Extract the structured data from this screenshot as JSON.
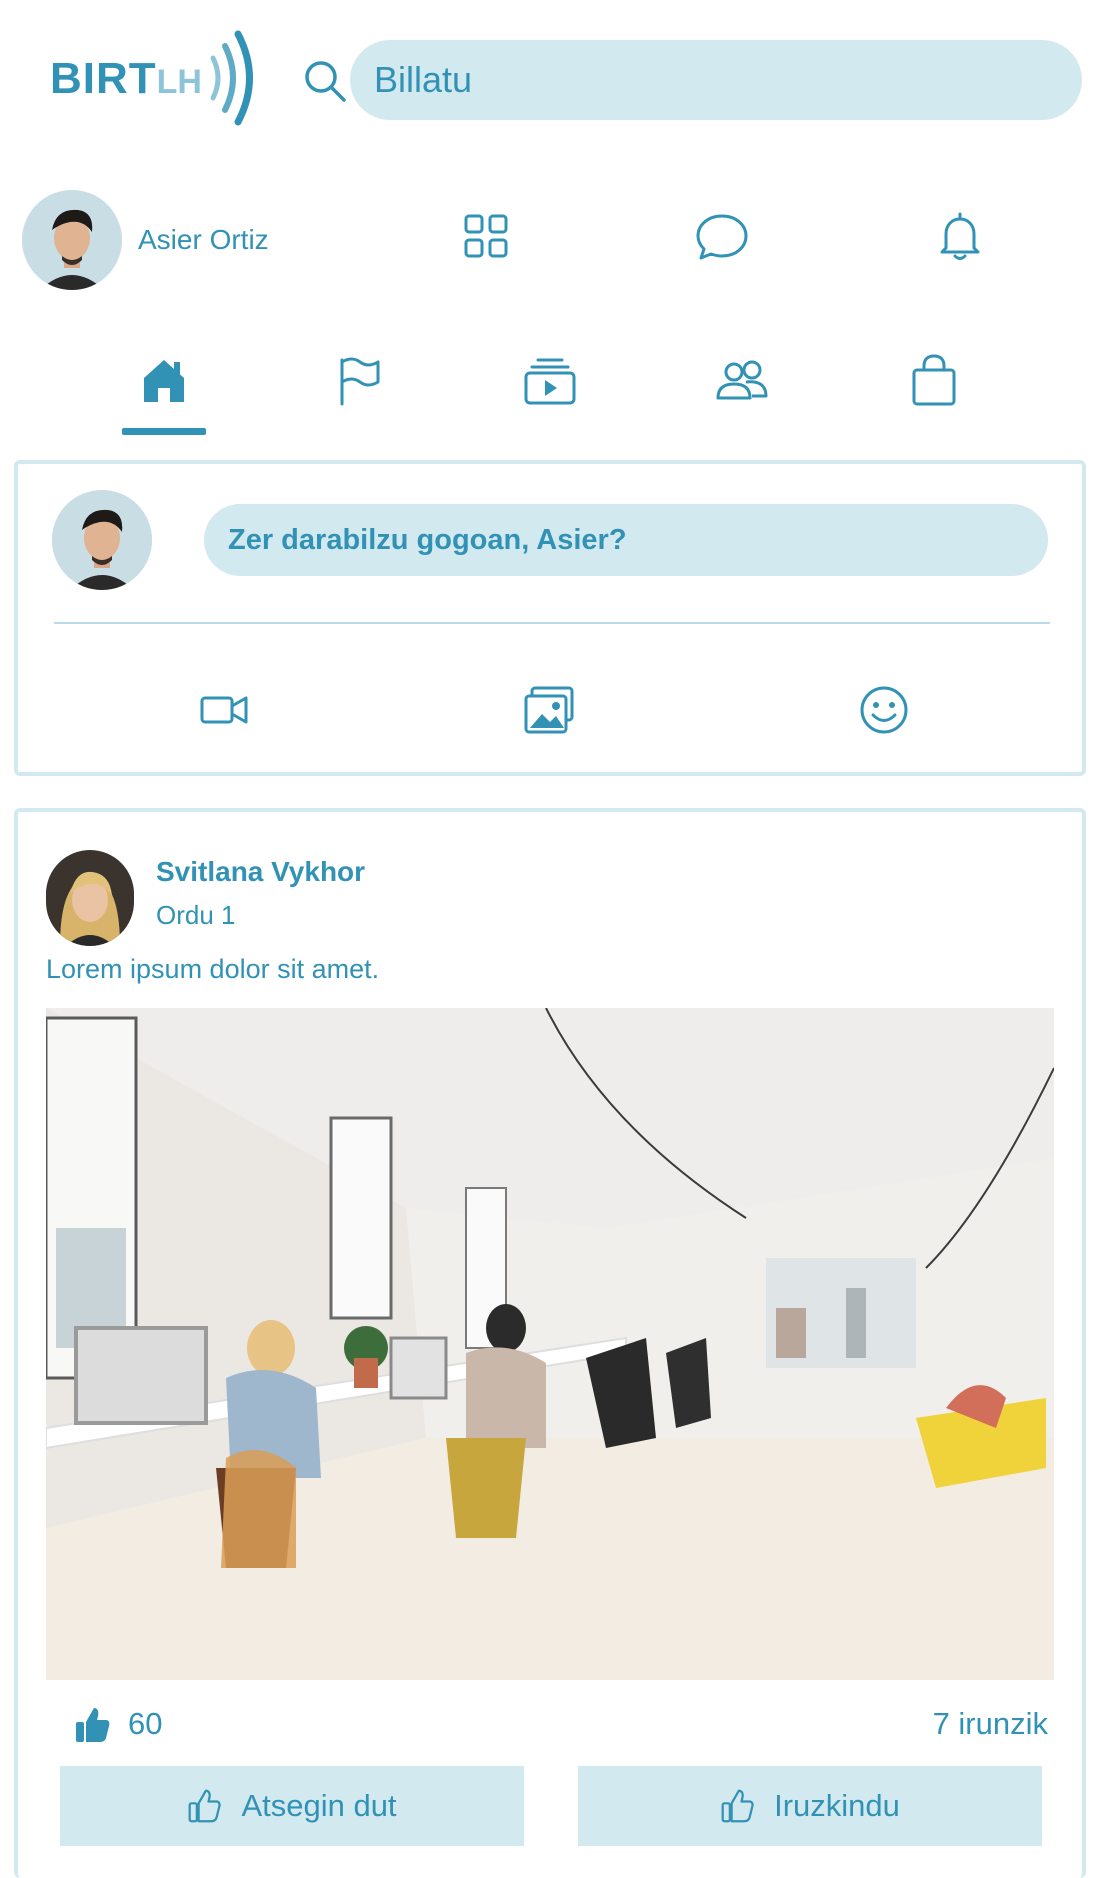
{
  "brand": {
    "logo_main": "BIRT",
    "logo_sub": "LH"
  },
  "search": {
    "value": "Billatu"
  },
  "user": {
    "name": "Asier Ortiz"
  },
  "top_icons": [
    "grid-icon",
    "chat-icon",
    "bell-icon"
  ],
  "nav_tabs": [
    {
      "name": "home",
      "active": true
    },
    {
      "name": "flag",
      "active": false
    },
    {
      "name": "video",
      "active": false
    },
    {
      "name": "groups",
      "active": false
    },
    {
      "name": "shop",
      "active": false
    }
  ],
  "composer": {
    "prompt": "Zer darabilzu gogoan, Asier?",
    "actions": [
      "video-camera-icon",
      "photo-icon",
      "emoji-icon"
    ]
  },
  "post": {
    "author": "Svitlana Vykhor",
    "time": "Ordu 1",
    "text": "Lorem ipsum dolor sit amet.",
    "likes": "60",
    "comments": "7 irunzik",
    "like_button": "Atsegin dut",
    "comment_button": "Iruzkindu"
  },
  "colors": {
    "accent": "#3192b5",
    "pill": "#d3e9f0",
    "border": "#d3e9f0"
  }
}
